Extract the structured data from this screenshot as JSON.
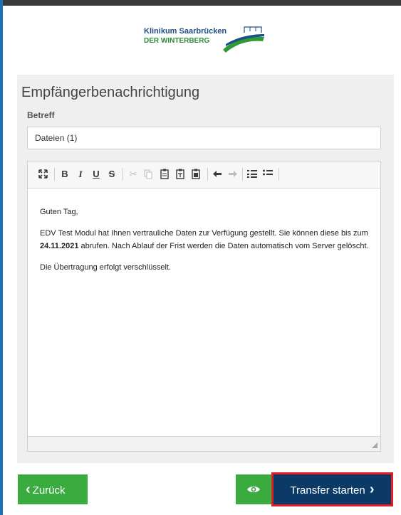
{
  "logo": {
    "line1": "Klinikum Saarbrücken",
    "line2": "DER WINTERBERG"
  },
  "panel": {
    "title": "Empfängerbenachrichtigung",
    "subject_label": "Betreff",
    "subject_value": "Dateien (1)"
  },
  "toolbar": {
    "icons": [
      "maximize-icon",
      "bold-icon",
      "italic-icon",
      "underline-icon",
      "strikethrough-icon",
      "cut-icon",
      "copy-icon",
      "paste-icon",
      "paste-text-icon",
      "paste-word-icon",
      "undo-icon",
      "redo-icon",
      "numbered-list-icon",
      "bulleted-list-icon"
    ],
    "bold": "B",
    "italic": "I",
    "underline": "U",
    "strike": "S"
  },
  "message": {
    "greeting": "Guten Tag,",
    "body_before": "EDV Test Modul hat Ihnen vertrauliche Daten zur Verfügung gestellt. Sie können diese bis zum ",
    "date": "24.11.2021",
    "body_after": " abrufen. Nach Ablauf der Frist werden die Daten automatisch vom Server gelöscht.",
    "note": "Die Übertragung erfolgt verschlüsselt."
  },
  "buttons": {
    "back_icon": "‹",
    "back": "Zurück",
    "transfer": "Transfer starten",
    "transfer_icon": "›"
  },
  "colors": {
    "green": "#3aab3f",
    "navy": "#0b3a66",
    "highlight": "#e11d25",
    "accent_blue": "#1f6fb5"
  }
}
